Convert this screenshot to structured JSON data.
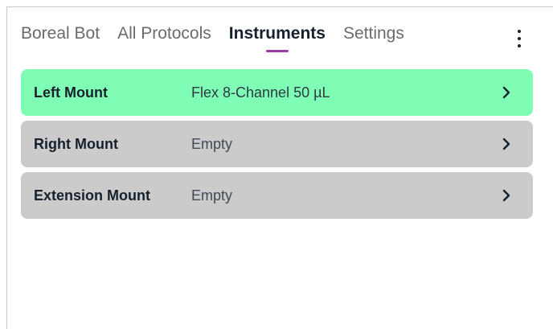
{
  "nav": {
    "tabs": [
      {
        "label": "Boreal Bot",
        "active": false
      },
      {
        "label": "All Protocols",
        "active": false
      },
      {
        "label": "Instruments",
        "active": true
      },
      {
        "label": "Settings",
        "active": false
      }
    ],
    "overflow_icon": "more-vertical-icon",
    "active_underline_color": "#9c3ba4"
  },
  "mounts": [
    {
      "name": "Left Mount",
      "instrument": "Flex 8-Channel 50 µL",
      "attached": true,
      "icon": "chevron-right-icon"
    },
    {
      "name": "Right Mount",
      "instrument": "Empty",
      "attached": false,
      "icon": "chevron-right-icon"
    },
    {
      "name": "Extension Mount",
      "instrument": "Empty",
      "attached": false,
      "icon": "chevron-right-icon"
    }
  ],
  "colors": {
    "attached_row": "#80fdb4",
    "empty_row": "#cbcbcb",
    "text_primary": "#16212d"
  }
}
